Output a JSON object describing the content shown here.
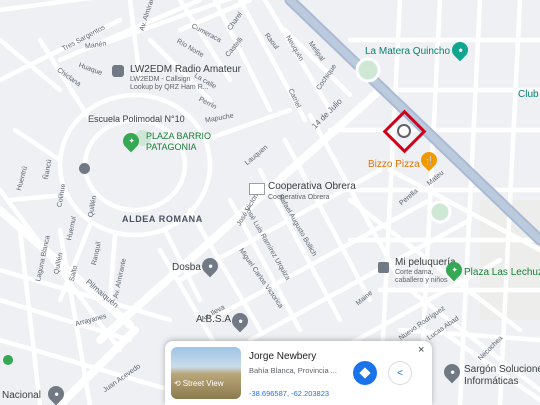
{
  "map": {
    "streets": {
      "tres_sargentos": "Tres Sargentos",
      "marien": "Marién",
      "chiclana": "Chiclana",
      "huaque": "Huaque",
      "av_almirante_top": "Av. Almirante",
      "cumeraca": "Cumeraca",
      "charel": "Charel",
      "castelli": "Castelli",
      "raoul": "Raoul",
      "neuquen": "Neuquén",
      "melipal": "Melipal",
      "cochique": "Cochique",
      "la_calle": "La calle",
      "rio_norte": "Río Norte",
      "perrin": "Perrín",
      "catriel": "Catriel",
      "catulo": "Catulo",
      "catalunia": "Cataluña",
      "catorce_julio": "14 de Julio",
      "lauquen": "Lauquen",
      "calle_mapuche": "Mapuche",
      "huentru": "Huentrú",
      "nacu": "Ñancú",
      "quillen": "Quillén",
      "colihue": "Colihue",
      "huemul": "Huemul",
      "laguna_blanca": "Laguna Blanca",
      "quilla": "Quillén",
      "salto": "Salto",
      "ranquil": "Ranquil",
      "av_almirante_mid": "Av. Almirante",
      "pilmaiquen": "Pilmaiquén",
      "arrayanes": "Arrayanes",
      "juan_acevedo": "Juan Acevedo",
      "jose_luis_ramirez": "José Luis Ramírez Urquiza",
      "rafael_bollich": "Rafael Augusto Bollich",
      "jose_victorino": "José Victorino",
      "miguel_carlos_victorica": "Miguel Carlos Victorica",
      "perella": "Perella",
      "mateu": "Mateu",
      "maine": "Maine",
      "lucas_abad": "Lucas Abad",
      "nuevo_rodrigues": "Nuevo Rodríguez",
      "necochea": "Necochea",
      "a_lluva": "Av. Ileva"
    },
    "pois": {
      "lw2edm": {
        "name": "LW2EDM Radio Amateur",
        "sub1": "LW2EDM - Callsign",
        "sub2": "Lookup by QRZ Ham R..."
      },
      "escuela": "Escuela Polimodal N°10",
      "plaza_barrio_1": "PLAZA BARRIO",
      "plaza_barrio_2": "PATAGONIA",
      "aldea": "ALDEA ROMANA",
      "la_matera": "La Matera Quincho",
      "club": "Club",
      "bizzo": "Bizzo Pizza",
      "cooperativa": {
        "name": "Cooperativa Obrera",
        "sub": "Cooperativa Obrera"
      },
      "dosba": "Dosba",
      "absa": "A.B.S.A",
      "peluqueria": {
        "name": "Mi peluquería",
        "sub1": "Corte dama,",
        "sub2": "caballero y niños"
      },
      "plaza_lechuzas": "Plaza Las Lechuz",
      "sargon": {
        "line1": "Sargón Solucione",
        "line2": "Informáticas"
      },
      "nacional": "Nacional"
    },
    "icons": {
      "pin_teal": "#0fa58f",
      "pin_gray": "#717a84",
      "pin_green": "#34a853",
      "pin_orange": "#f29900",
      "road_main": "#a9bad4"
    }
  },
  "place_card": {
    "title": "Jorge Newbery",
    "address": "Bahía Blanca, Provincia ...",
    "coords": "-38.696587, -62.203823",
    "street_view_label": "Street View",
    "close": "×"
  }
}
